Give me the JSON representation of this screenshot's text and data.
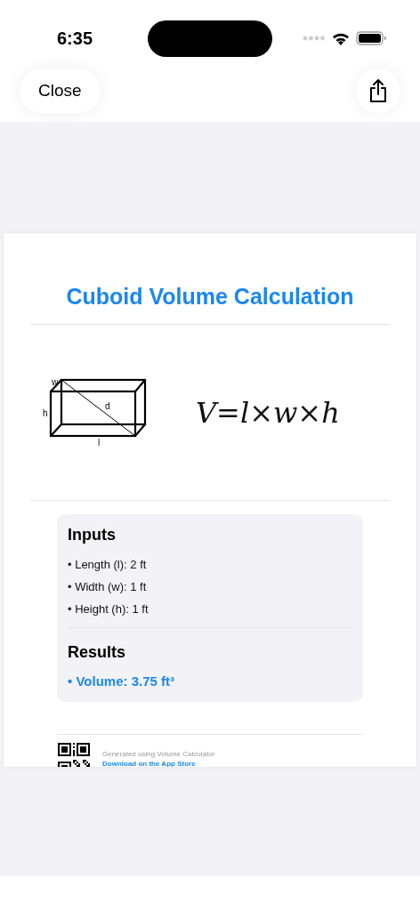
{
  "status_bar": {
    "time": "6:35"
  },
  "nav_bar": {
    "close_button": "Close"
  },
  "document": {
    "title": "Cuboid Volume Calculation",
    "figure": {
      "labels": [
        {
          "kind": "w",
          "text": "w"
        },
        {
          "kind": "h",
          "text": "h"
        },
        {
          "kind": "d",
          "text": "d"
        },
        {
          "kind": "l",
          "text": "l"
        }
      ],
      "formula": "V=l×w×h"
    },
    "inputs": {
      "heading": "Inputs",
      "items": [
        "• Length (l): 2 ft",
        "• Width (w): 1 ft",
        "• Height (h): 1 ft"
      ]
    },
    "results": {
      "heading": "Results",
      "items": [
        "• Volume: 3.75 ft³"
      ]
    },
    "footer": {
      "caption": "Generated using Volume Calculator",
      "link": "Download on the App Store"
    }
  }
}
